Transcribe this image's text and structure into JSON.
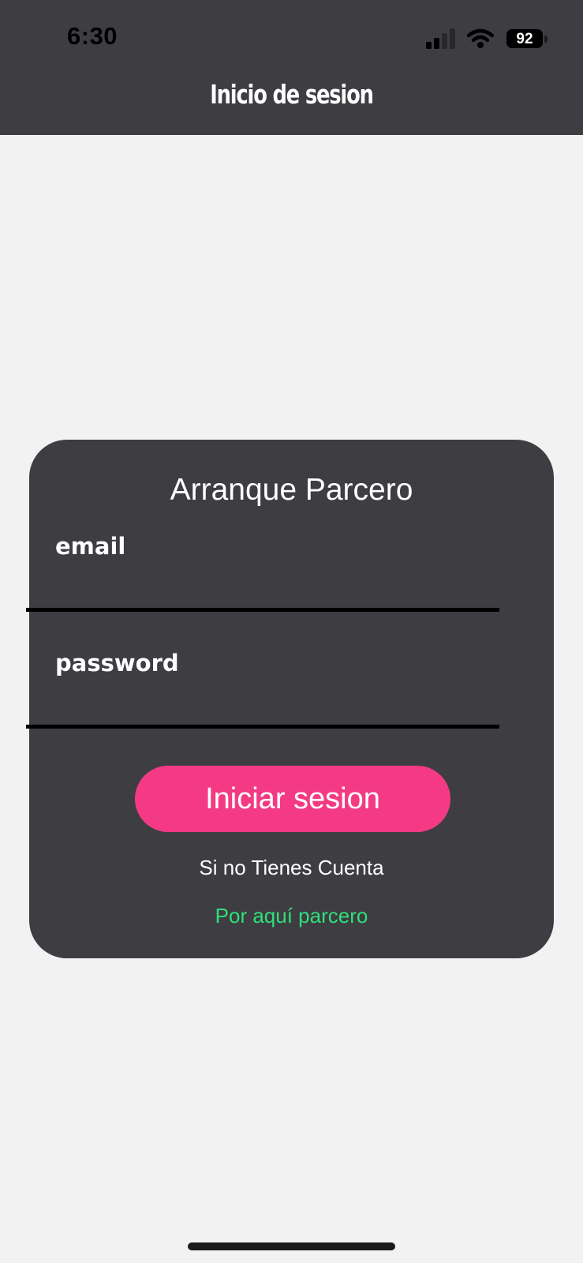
{
  "status_bar": {
    "time": "6:30",
    "battery_level": "92",
    "signal_icon": "cellular-signal-icon",
    "wifi_icon": "wifi-icon",
    "battery_icon": "battery-icon"
  },
  "header": {
    "title": "Inicio de sesion"
  },
  "login_card": {
    "title": "Arranque Parcero",
    "email_label": "email",
    "email_value": "",
    "password_label": "password",
    "password_value": "",
    "submit_label": "Iniciar sesion",
    "no_account_text": "Si no Tienes Cuenta",
    "register_link": "Por aquí parcero"
  },
  "colors": {
    "header_background": "#3e3d42",
    "page_background": "#f2f2f2",
    "card_background": "#3e3d42",
    "button_background": "#f43a84",
    "link_color": "#2fe07a",
    "text_color": "#ffffff"
  }
}
